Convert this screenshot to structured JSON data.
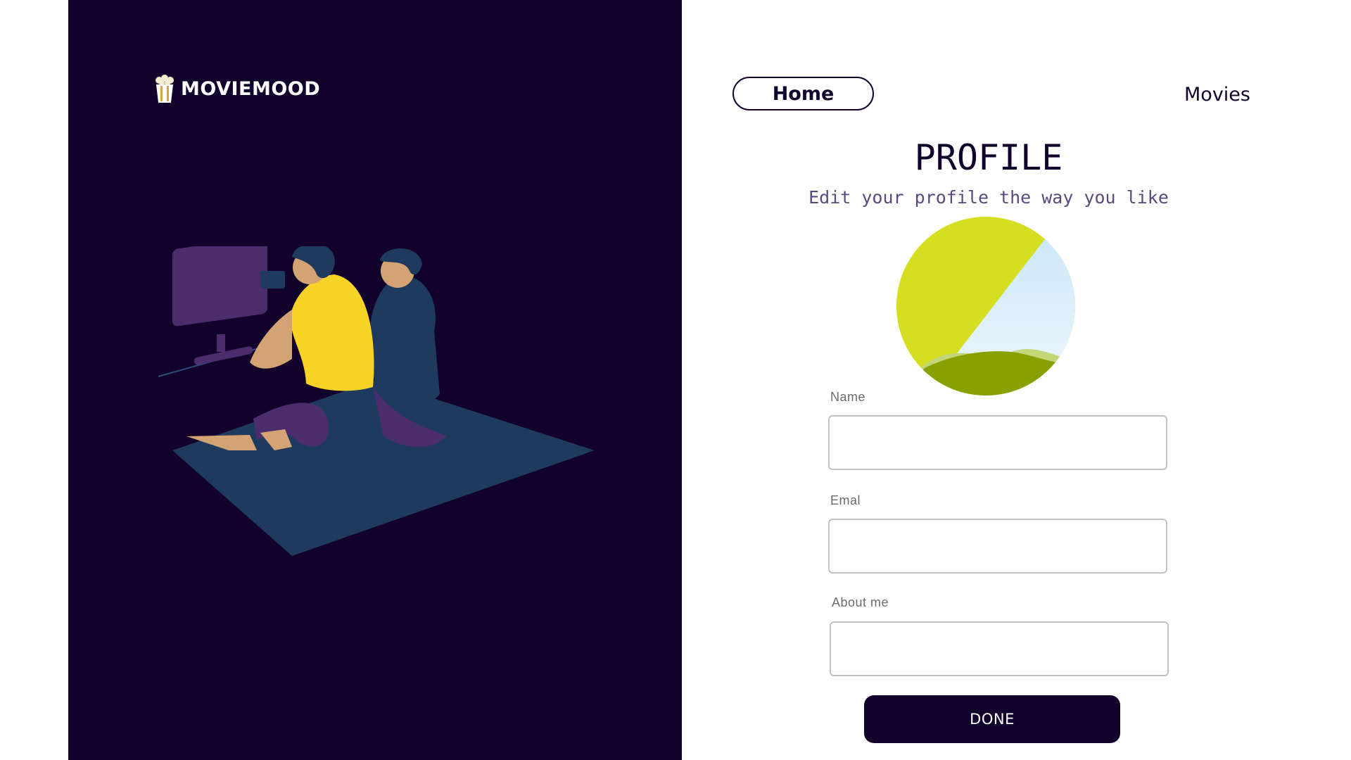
{
  "brand": {
    "name": "MOVIEMOOD",
    "icon": "popcorn-icon"
  },
  "nav": {
    "home_label": "Home",
    "movies_label": "Movies"
  },
  "profile": {
    "title": "PROFILE",
    "subtitle": "Edit your profile the way you like",
    "avatar_icon": "landscape-placeholder-icon"
  },
  "form": {
    "name_label": "Name",
    "name_value": "",
    "email_label": "Emal",
    "email_value": "",
    "about_label": "About me",
    "about_value": "",
    "submit_label": "DONE"
  },
  "colors": {
    "primary_dark": "#12012a",
    "tv_purple": "#4b2d6e",
    "rug_blue": "#1e3a5f",
    "shirt_yellow": "#f7d327",
    "avatar_lime": "#d6de22",
    "avatar_sky": "#d6eefa",
    "avatar_hill": "#88a100"
  }
}
